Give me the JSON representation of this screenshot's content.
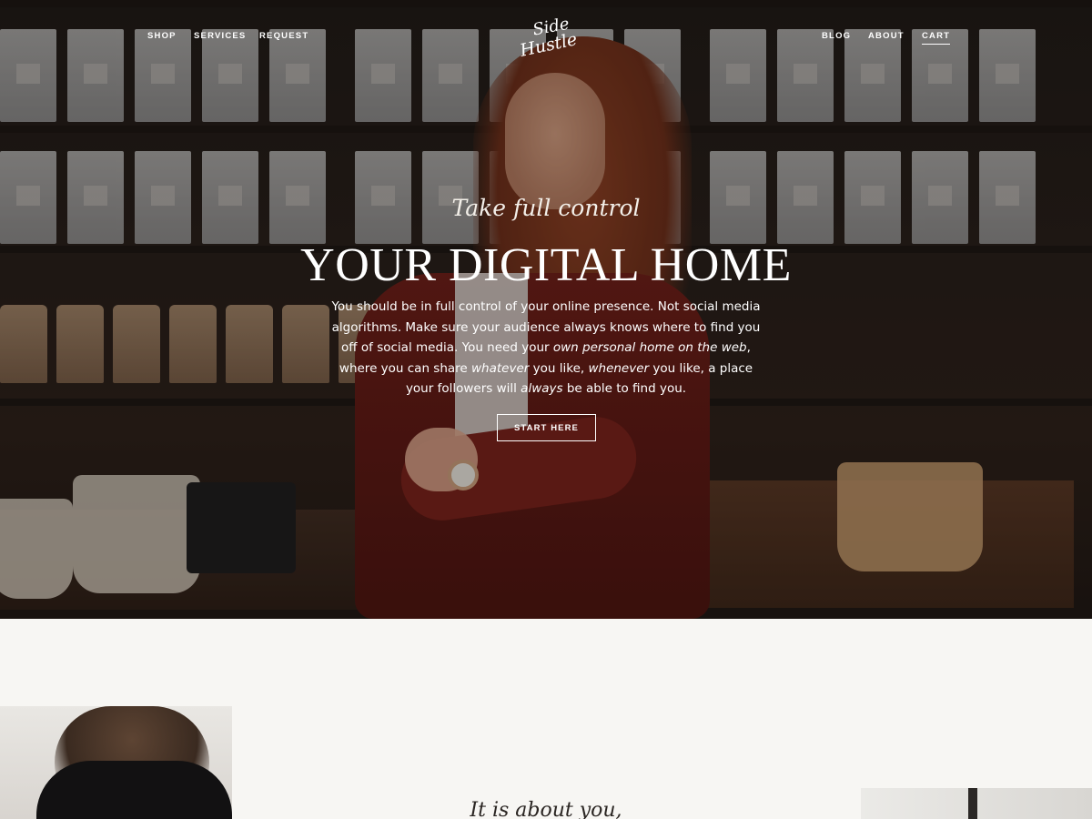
{
  "nav": {
    "left": [
      "SHOP",
      "SERVICES",
      "REQUEST"
    ],
    "right": [
      "BLOG",
      "ABOUT",
      "CART"
    ],
    "logo_text": [
      "Side",
      "Hustle"
    ]
  },
  "hero": {
    "tagline": "Take full control",
    "headline": "YOUR DIGITAL HOME",
    "body_parts": {
      "p1": "You should be in full control of your online presence. Not social media algorithms. Make sure your audience always knows where to find you off of social media. You need your ",
      "em1": "own personal home on the web",
      "p2": ", where you can share ",
      "em2": "whatever",
      "p3": " you like, ",
      "em3": "whenever",
      "p4": " you like, a place your followers will ",
      "em4": "always",
      "p5": " be able to find you."
    },
    "cta_label": "START HERE"
  },
  "about": {
    "script_heading": "It is about you,"
  },
  "colors": {
    "text_light": "#ffffff",
    "page_background": "#f7f6f3",
    "jacket": "#5a1612"
  }
}
